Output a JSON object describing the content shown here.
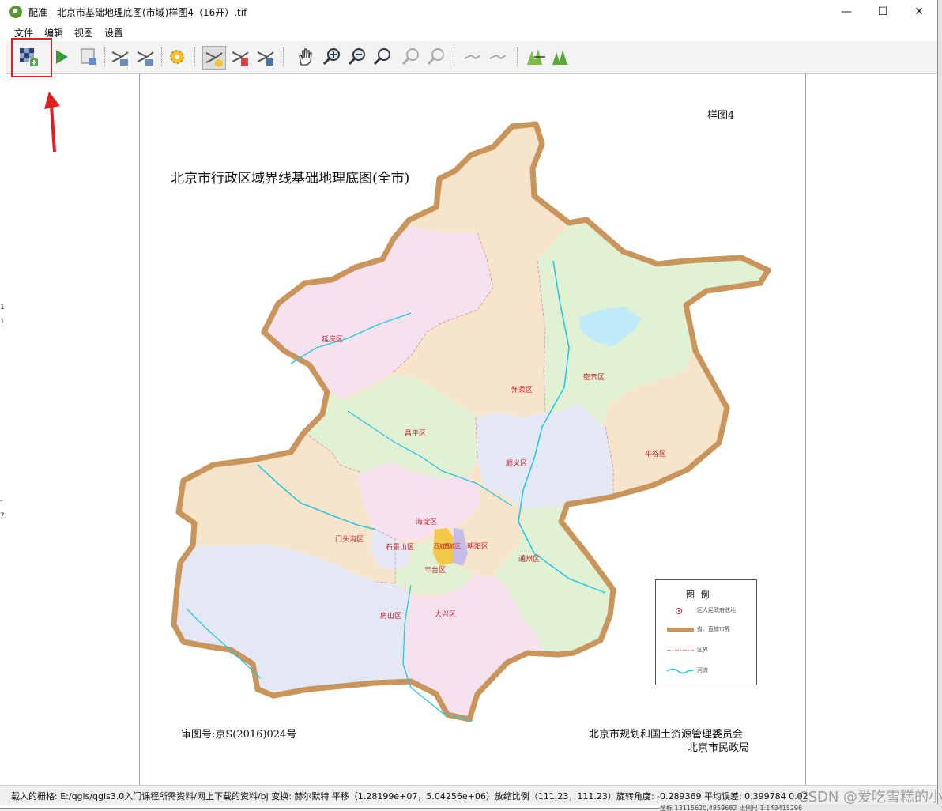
{
  "window": {
    "title": "配准 - 北京市基础地理底图(市域)样图4（16开）.tif",
    "minimize": "—",
    "maximize": "☐",
    "close": "✕"
  },
  "menu": [
    "文件",
    "编辑",
    "视图",
    "设置"
  ],
  "toolbar": {
    "icons": [
      "open-raster-icon",
      "start-georeferencing-icon",
      "generate-gdal-script-icon",
      "load-gcp-points-icon",
      "save-gcp-points-icon",
      "transformation-settings-icon",
      "add-point-icon",
      "delete-point-icon",
      "move-gcp-point-icon",
      "pan-icon",
      "zoom-in-icon",
      "zoom-out-icon",
      "zoom-to-layer-icon",
      "zoom-last-icon",
      "zoom-next-icon",
      "link-georeferencer-icon",
      "link-qgis-icon",
      "full-histogram-stretch-icon",
      "local-histogram-stretch-icon"
    ]
  },
  "map": {
    "sheet_label": "样图4",
    "title": "北京市行政区域界线基础地理底图(全市)",
    "permit": "审图号:京S(2016)024号",
    "org1": "北京市规划和国土资源管理委员会",
    "org2": "北京市民政局",
    "districts": [
      "延庆区",
      "怀柔区",
      "密云区",
      "昌平区",
      "顺义区",
      "平谷区",
      "海淀区",
      "门头沟区",
      "石景山区",
      "朝阳区",
      "东城区",
      "西城区",
      "丰台区",
      "通州区",
      "房山区",
      "大兴区"
    ],
    "legend": {
      "title": "图    例",
      "items": [
        "区人民政府驻地",
        "省、直辖市界",
        "区界",
        "河流"
      ]
    },
    "colors": {
      "boundary": "#c9955a",
      "river": "#28c8e0",
      "pink": "#f6e2ef",
      "peach": "#f6e4cb",
      "green": "#e1f1d3",
      "blue": "#e4e8f4",
      "yellow": "#f2c84b",
      "purple": "#c5bde8"
    }
  },
  "status": {
    "text": "载入的栅格:  E:/qgis/qgis3.0入门课程所需资料/网上下载的资料/bj 变换:  赫尔默特 平移（1.28199e+07，5.04256e+06）放缩比例（111.23，111.23）旋转角度: -0.289369 平均误差: 0.399784 0.02",
    "bottom": "坐标 13115620,4859682   比例尺 1:143415296",
    "watermark": "CSDN @爱吃雪糕的小布丁"
  },
  "left_fragments": [
    "1",
    "1",
    "-",
    "7."
  ]
}
